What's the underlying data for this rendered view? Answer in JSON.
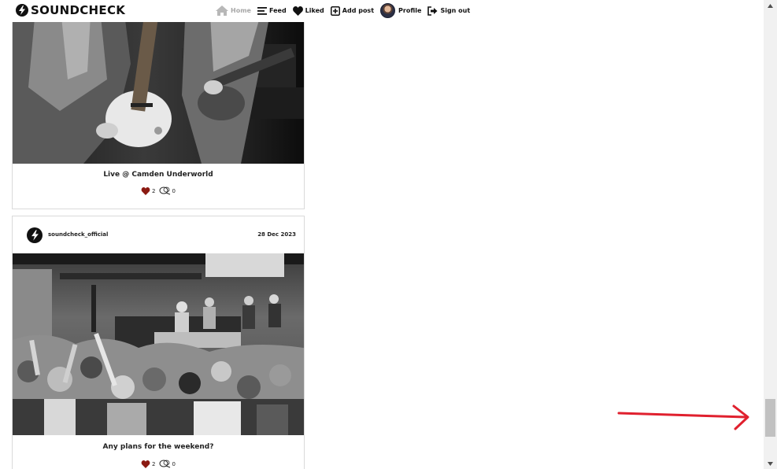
{
  "brand": {
    "name": "SOUNDCHECK"
  },
  "nav": {
    "home": "Home",
    "feed": "Feed",
    "liked": "Liked",
    "add_post": "Add post",
    "profile": "Profile",
    "sign_out": "Sign out",
    "active": "Home"
  },
  "posts": [
    {
      "caption": "Live @ Camden Underworld",
      "likes": "2",
      "comments": "0",
      "image": "black-and-white photo of guitarists playing on stage"
    },
    {
      "author": "soundcheck_official",
      "date": "28 Dec 2023",
      "caption": "Any plans for the weekend?",
      "likes": "2",
      "comments": "0",
      "image": "black-and-white photo of a crowd at a club with DJ booth"
    }
  ],
  "colors": {
    "heart": "#8b1a12",
    "annotation_arrow": "#e0202e",
    "nav_active": "#a8a8a8"
  },
  "icons": {
    "home": "home-icon",
    "feed": "menu-lines-icon",
    "liked": "heart-icon",
    "add_post": "plus-square-icon",
    "sign_out": "sign-out-icon",
    "comment": "comment-bubble-icon"
  }
}
